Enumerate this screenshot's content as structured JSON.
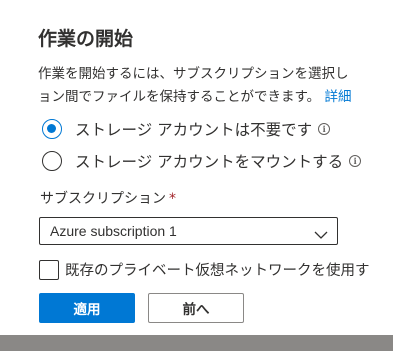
{
  "dialog": {
    "title": "作業の開始",
    "description_line1": "作業を開始するには、サブスクリプションを選択し",
    "description_line2": "ョン間でファイルを保持することができます。",
    "description_link": "詳細",
    "options": [
      {
        "label": "ストレージ アカウントは不要です",
        "selected": true,
        "info_icon": "info-icon"
      },
      {
        "label": "ストレージ アカウントをマウントする",
        "selected": false,
        "info_icon": "info-icon"
      }
    ],
    "subscription": {
      "label": "サブスクリプション",
      "required_marker": "*",
      "value": "Azure subscription 1",
      "chevron_icon": "chevron-down-icon"
    },
    "private_network": {
      "label": "既存のプライベート仮想ネットワークを使用す",
      "checked": false
    },
    "buttons": {
      "apply": "適用",
      "back": "前へ"
    }
  },
  "colors": {
    "accent": "#0078d4",
    "text": "#323130",
    "required": "#a4262c",
    "backdrop": "#8a8886"
  }
}
